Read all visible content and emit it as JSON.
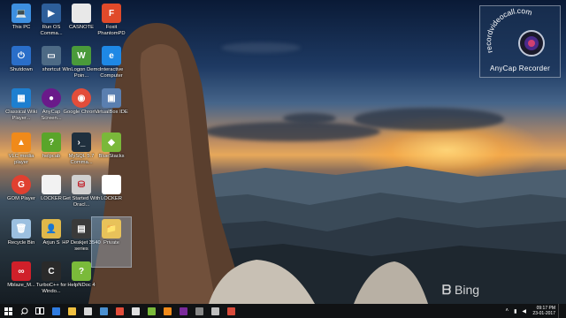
{
  "desktop": {
    "icons": [
      {
        "label": "This PC",
        "color": "#3d8fe0",
        "glyph": "💻"
      },
      {
        "label": "Run OS Comma...",
        "color": "#2d5e9a",
        "glyph": "▶"
      },
      {
        "label": "CASNOTE",
        "color": "#e8e8e8",
        "glyph": ""
      },
      {
        "label": "Foxit PhantomPD",
        "color": "#e04a2a",
        "glyph": "F"
      },
      {
        "label": "Shutdown",
        "color": "#2a6ec9",
        "glyph": "⏻"
      },
      {
        "label": "shortcut",
        "color": "#4d6a85",
        "glyph": "▭"
      },
      {
        "label": "WinLogon Demo Poin...",
        "color": "#4a9a3a",
        "glyph": "W"
      },
      {
        "label": "Interactive Computer",
        "color": "#1e88e5",
        "glyph": "e"
      },
      {
        "label": "Classical Wiki Player...",
        "color": "#1e7fd0",
        "glyph": "▦"
      },
      {
        "label": "AnyCap Screen...",
        "color": "#6a1a8a",
        "glyph": "●"
      },
      {
        "label": "Google Chrome",
        "color": "#e9e9e9",
        "glyph": "◉"
      },
      {
        "label": "VirtualBox IDE",
        "color": "#5a7fb0",
        "glyph": "▣"
      },
      {
        "label": "VLC media player",
        "color": "#f08a1a",
        "glyph": "▲"
      },
      {
        "label": "helpcab",
        "color": "#5aa52a",
        "glyph": "?"
      },
      {
        "label": "MySQL 5.7 Comma...",
        "color": "#20303e",
        "glyph": "›_"
      },
      {
        "label": "BlueStacks",
        "color": "#7ab83a",
        "glyph": "◆"
      },
      {
        "label": "GOM Player",
        "color": "#e04030",
        "glyph": "G"
      },
      {
        "label": "LOCKER",
        "color": "#f2f2f2",
        "glyph": ""
      },
      {
        "label": "Get Started With Oracl...",
        "color": "#d0d0d0",
        "glyph": "⛁"
      },
      {
        "label": "LOCKER",
        "color": "#ffffff",
        "glyph": ""
      },
      {
        "label": "Recycle Bin",
        "color": "#9cc0e0",
        "glyph": "🗑"
      },
      {
        "label": "Arjun S",
        "color": "#e0b84a",
        "glyph": "👤"
      },
      {
        "label": "HP Deskjet 3540 series",
        "color": "#3a3a3a",
        "glyph": "▤"
      },
      {
        "label": "Private",
        "color": "#e8c25a",
        "glyph": "📁"
      },
      {
        "label": "Mblaze_M...",
        "color": "#d0202a",
        "glyph": "∞"
      },
      {
        "label": "TurboC++ for Windo...",
        "color": "#2a2a2a",
        "glyph": "C"
      },
      {
        "label": "HelpNDoc 4",
        "color": "#7aba3a",
        "glyph": "?"
      }
    ]
  },
  "watermark": {
    "site": "recordvideocall.com",
    "product": "AnyCap Recorder"
  },
  "bing": "Bing",
  "taskbar": {
    "apps": [
      {
        "name": "start-icon",
        "color": "#ffffff"
      },
      {
        "name": "search-icon",
        "color": "#ffffff"
      },
      {
        "name": "edge-icon",
        "color": "#2f7ce0"
      },
      {
        "name": "file-explorer-icon",
        "color": "#f0c040"
      },
      {
        "name": "store-icon",
        "color": "#d8d8d8"
      },
      {
        "name": "mail-icon",
        "color": "#4a90d0"
      },
      {
        "name": "chrome-icon",
        "color": "#e24d3a"
      },
      {
        "name": "app-icon",
        "color": "#e0e0e0"
      },
      {
        "name": "helpndoc-icon",
        "color": "#7aba3a"
      },
      {
        "name": "vlc-icon",
        "color": "#f08a1a"
      },
      {
        "name": "anycap-icon",
        "color": "#7a2a9a"
      },
      {
        "name": "cmd-icon",
        "color": "#888888"
      },
      {
        "name": "notepad-icon",
        "color": "#bfbfbf"
      },
      {
        "name": "app2-icon",
        "color": "#d84a3a"
      }
    ],
    "time": "09:17 PM",
    "date": "23-01-2017"
  }
}
